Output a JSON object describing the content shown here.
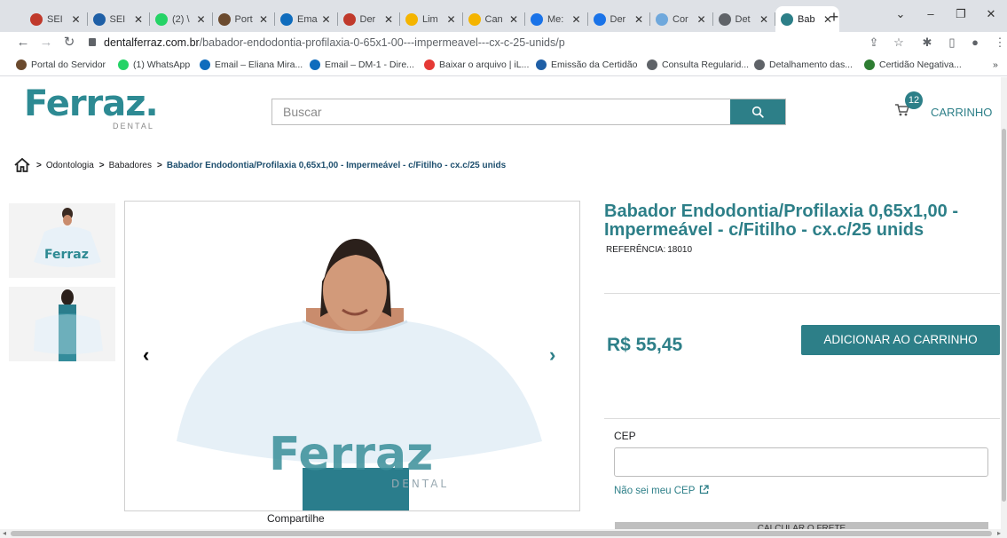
{
  "browser": {
    "tabs": [
      {
        "title": "SEI",
        "color": "#c0392b"
      },
      {
        "title": "SEI",
        "color": "#1f5fa6"
      },
      {
        "title": "(2) \\",
        "color": "#25d366"
      },
      {
        "title": "Port",
        "color": "#6b4a2e"
      },
      {
        "title": "Ema",
        "color": "#0f6cbd"
      },
      {
        "title": "Der",
        "color": "#c0392b"
      },
      {
        "title": "Lim",
        "color": "#f4b400"
      },
      {
        "title": "Can",
        "color": "#f4b400"
      },
      {
        "title": "Me:",
        "color": "#1a73e8"
      },
      {
        "title": "Der",
        "color": "#1a73e8"
      },
      {
        "title": "Cor",
        "color": "#6fa8dc"
      },
      {
        "title": "Det",
        "color": "#5f6368"
      },
      {
        "title": "Bab",
        "color": "#2d7f88",
        "active": true
      }
    ],
    "url": {
      "host": "dentalferraz.com.br",
      "path": "/babador-endodontia-profilaxia-0-65x1-00---impermeavel---cx-c-25-unids/p"
    },
    "bookmarks": [
      {
        "label": "Portal do Servidor",
        "color": "#6b4a2e"
      },
      {
        "label": "(1) WhatsApp",
        "color": "#25d366"
      },
      {
        "label": "Email – Eliana Mira...",
        "color": "#0f6cbd"
      },
      {
        "label": "Email – DM-1 - Dire...",
        "color": "#0f6cbd"
      },
      {
        "label": "Baixar o arquivo | iL...",
        "color": "#e53935"
      },
      {
        "label": "Emissão da Certidão",
        "color": "#1f5fa6"
      },
      {
        "label": "Consulta Regularid...",
        "color": "#5f6368"
      },
      {
        "label": "Detalhamento das...",
        "color": "#5f6368"
      },
      {
        "label": "Certidão Negativa...",
        "color": "#2e7d32"
      }
    ],
    "more_bookmarks": "»"
  },
  "header": {
    "logo_text": "Ferraz.",
    "logo_sub": "DENTAL",
    "search_placeholder": "Buscar",
    "cart_count": "12",
    "cart_label": "CARRINHO"
  },
  "breadcrumb": {
    "items": [
      "Odontologia",
      "Babadores"
    ],
    "current": "Babador Endodontia/Profilaxia 0,65x1,00 - Impermeável - c/Fitilho - cx.c/25 unids"
  },
  "gallery": {
    "watermark": "Ferraz",
    "watermark_sub": "DENTAL",
    "share_label": "Compartilhe"
  },
  "product": {
    "title": "Babador Endodontia/Profilaxia 0,65x1,00 - Impermeável - c/Fitilho - cx.c/25 unids",
    "reference_label": "REFERÊNCIA:",
    "reference_value": "18010",
    "price": "R$ 55,45",
    "add_to_cart": "ADICIONAR AO CARRINHO",
    "cep_label": "CEP",
    "cep_value": "",
    "cep_help": "Não sei meu CEP",
    "calc_label": "CALCULAR O FRETE"
  },
  "colors": {
    "brand": "#2d7f88",
    "breadcrumb_current": "#1e4f6e"
  }
}
